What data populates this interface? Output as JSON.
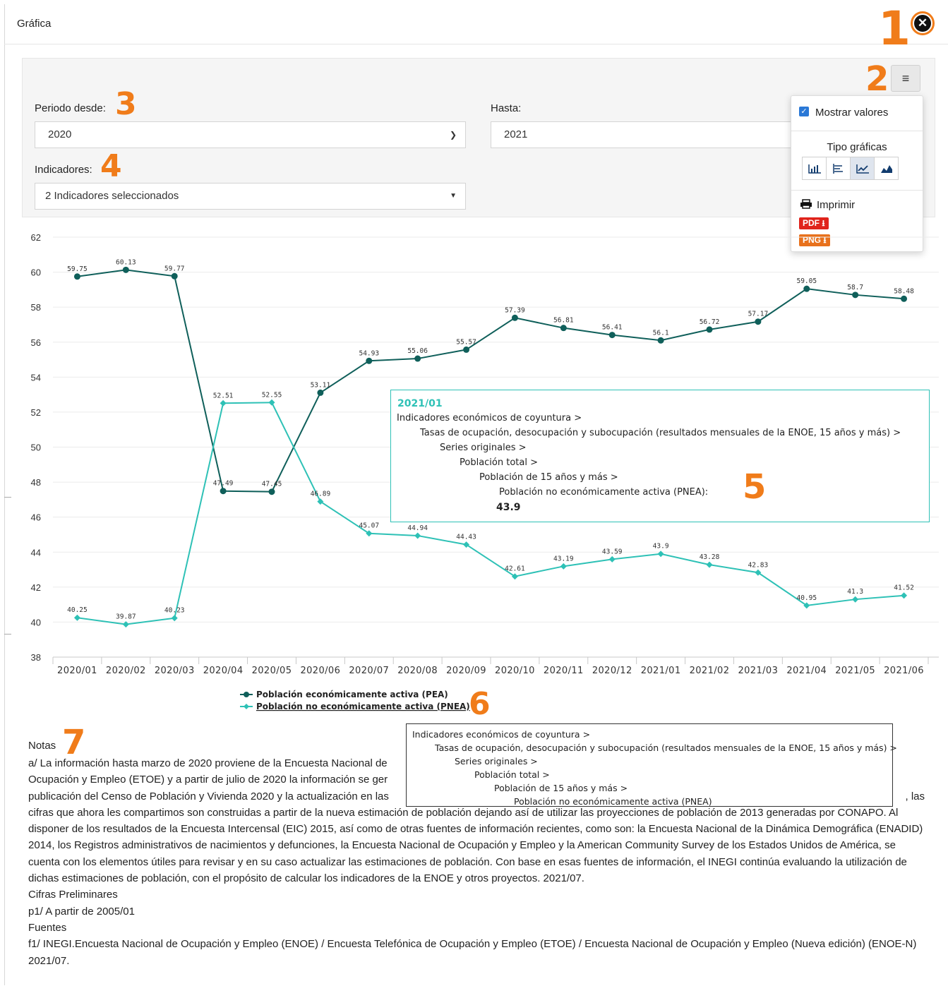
{
  "modal": {
    "title": "Gráfica",
    "close_symbol": "✕"
  },
  "callouts": [
    "1",
    "2",
    "3",
    "4",
    "5",
    "6",
    "7"
  ],
  "filters": {
    "period_from_label": "Periodo desde:",
    "period_from_value": "2020",
    "period_to_label": "Hasta:",
    "period_to_value": "2021",
    "indicators_label": "Indicadores:",
    "indicators_value": "2 Indicadores seleccionados"
  },
  "menu": {
    "button_icon": "hamburger-icon",
    "show_values_label": "Mostrar valores",
    "show_values_checked": true,
    "chart_types_label": "Tipo gráficas",
    "chart_types": [
      "column-chart-icon",
      "bar-chart-icon",
      "line-chart-icon",
      "area-chart-icon"
    ],
    "active_chart_type": "line-chart-icon",
    "print_label": "Imprimir",
    "pdf_label": "PDF",
    "png_label": "PNG",
    "colors": {
      "pdf": "#e0231b",
      "png": "#e8711c",
      "checkbox": "#2a78d6"
    }
  },
  "chart_data": {
    "type": "line",
    "x": [
      "2020/01",
      "2020/02",
      "2020/03",
      "2020/04",
      "2020/05",
      "2020/06",
      "2020/07",
      "2020/08",
      "2020/09",
      "2020/10",
      "2020/11",
      "2020/12",
      "2021/01",
      "2021/02",
      "2021/03",
      "2021/04",
      "2021/05",
      "2021/06"
    ],
    "ylim": [
      38,
      62
    ],
    "yticks": [
      38,
      40,
      42,
      44,
      46,
      48,
      50,
      52,
      54,
      56,
      58,
      60,
      62
    ],
    "grid": true,
    "legend_position": "bottom",
    "series": [
      {
        "name": "Población económicamente activa (PEA)",
        "color": "#0f5f5a",
        "marker": "circle",
        "values": [
          59.75,
          60.13,
          59.77,
          47.49,
          47.45,
          53.11,
          54.93,
          55.06,
          55.57,
          57.39,
          56.81,
          56.41,
          56.1,
          56.72,
          57.17,
          59.05,
          58.7,
          58.48
        ]
      },
      {
        "name": "Población no económicamente activa (PNEA)",
        "color": "#2ec1b6",
        "marker": "diamond",
        "values": [
          40.25,
          39.87,
          40.23,
          52.51,
          52.55,
          46.89,
          45.07,
          44.94,
          44.43,
          42.61,
          43.19,
          43.59,
          43.9,
          43.28,
          42.83,
          40.95,
          41.3,
          41.52
        ]
      }
    ]
  },
  "tooltip": {
    "period": "2021/01",
    "lines": [
      "Indicadores económicos de coyuntura >",
      "Tasas de ocupación, desocupación y subocupación (resultados mensuales de la ENOE, 15 años y más) >",
      "Series originales >",
      "Población total >",
      "Población de 15 años y más >",
      "Población no económicamente activa (PNEA):"
    ],
    "value": "43.9"
  },
  "legend_hint": {
    "lines": [
      "Indicadores económicos de coyuntura >",
      "Tasas de ocupación, desocupación y subocupación (resultados mensuales de la ENOE, 15 años y más) >",
      "Series originales >",
      "Población total >",
      "Población de 15 años y más >",
      "Población no económicamente activa (PNEA)"
    ]
  },
  "notes": {
    "title": "Notas",
    "a_start": "a/ La información hasta marzo de 2020 proviene de la Encuesta Nacional de",
    "a_line2": "Ocupación y Empleo (ETOE) y a partir de julio de 2020 la información se ger",
    "a_line3": "publicación del Censo de Población y Vivienda 2020 y la actualización en las",
    "a_line3_end": ", las",
    "a_rest": "cifras que ahora les compartimos son construidas a partir de la nueva estimación de población dejando así de utilizar las proyecciones de población de 2013 generadas por CONAPO. Al disponer de los resultados de la Encuesta Intercensal (EIC) 2015, así como de otras fuentes de información recientes, como son: la Encuesta Nacional de la Dinámica Demográfica (ENADID) 2014, los Registros administrativos de nacimientos y defunciones, la Encuesta Nacional de Ocupación y Empleo y la American Community Survey de los Estados Unidos de América, se cuenta con los elementos útiles para revisar y en su caso actualizar las estimaciones de población. Con base en esas fuentes de información, el INEGI continúa evaluando la utilización de dichas estimaciones de población, con el propósito de calcular los indicadores de la ENOE y otros proyectos. 2021/07.",
    "prelim_title": "Cifras Preliminares",
    "p1": "p1/ A partir de 2005/01",
    "sources_title": "Fuentes",
    "f1": "f1/ INEGI.Encuesta Nacional de Ocupación y Empleo (ENOE) / Encuesta Telefónica de Ocupación y Empleo (ETOE) / Encuesta Nacional de Ocupación y Empleo (Nueva edición) (ENOE-N) 2021/07."
  }
}
